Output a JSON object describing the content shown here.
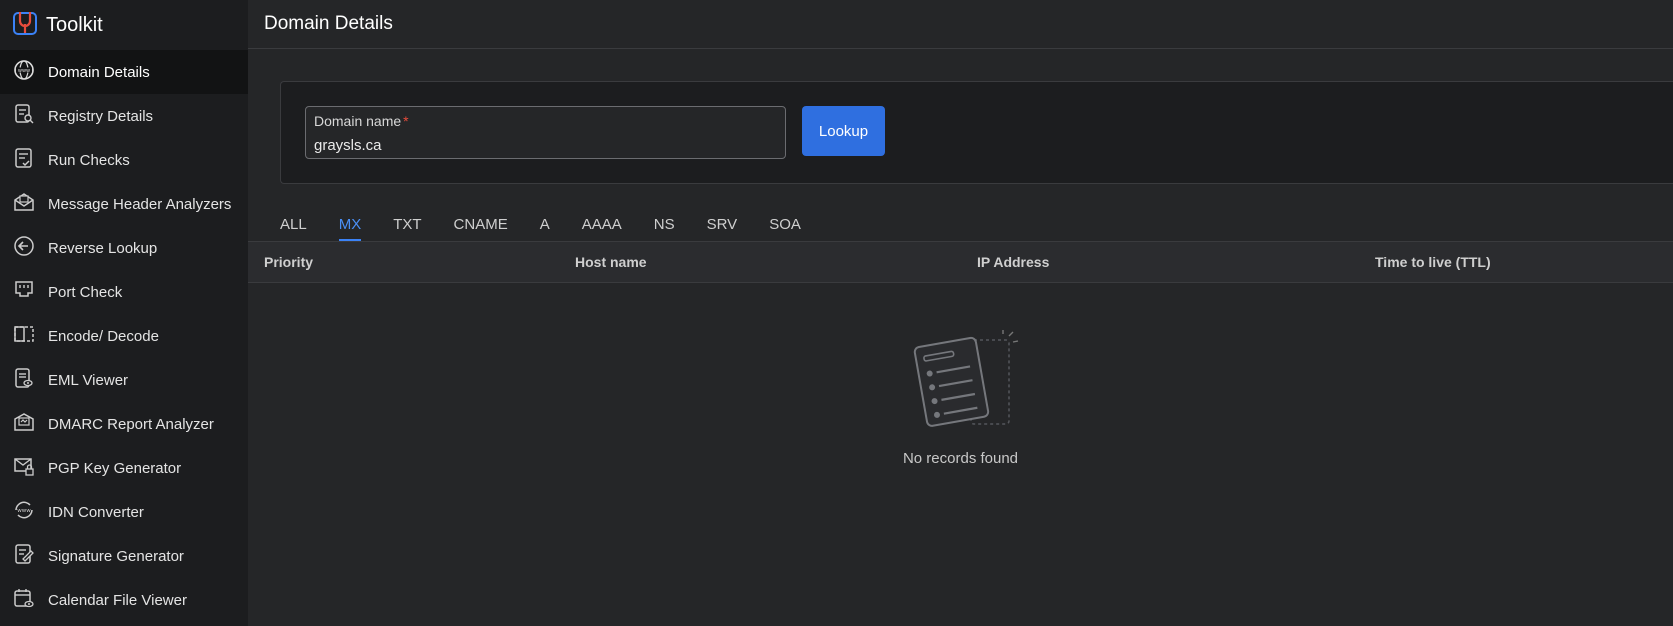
{
  "brand": {
    "name": "Toolkit",
    "logo_icon": "toolkit-logo-icon"
  },
  "sidebar": {
    "items": [
      {
        "label": "Domain Details",
        "icon": "globe-www-icon",
        "active": true
      },
      {
        "label": "Registry Details",
        "icon": "registry-doc-icon"
      },
      {
        "label": "Run Checks",
        "icon": "checklist-icon"
      },
      {
        "label": "Message Header Analyzers",
        "icon": "envelope-analyze-icon"
      },
      {
        "label": "Reverse Lookup",
        "icon": "reverse-arrow-icon"
      },
      {
        "label": "Port Check",
        "icon": "port-icon"
      },
      {
        "label": "Encode/ Decode",
        "icon": "split-box-icon"
      },
      {
        "label": "EML Viewer",
        "icon": "doc-eye-icon"
      },
      {
        "label": "DMARC Report Analyzer",
        "icon": "mail-report-icon"
      },
      {
        "label": "PGP Key Generator",
        "icon": "mail-lock-icon"
      },
      {
        "label": "IDN Converter",
        "icon": "www-refresh-icon"
      },
      {
        "label": "Signature Generator",
        "icon": "pen-doc-icon"
      },
      {
        "label": "Calendar File Viewer",
        "icon": "calendar-eye-icon"
      }
    ]
  },
  "header": {
    "title": "Domain Details"
  },
  "lookup": {
    "field_label": "Domain name",
    "required_mark": "*",
    "value": "graysls.ca",
    "button_label": "Lookup"
  },
  "tabs": [
    {
      "label": "ALL"
    },
    {
      "label": "MX",
      "active": true
    },
    {
      "label": "TXT"
    },
    {
      "label": "CNAME"
    },
    {
      "label": "A"
    },
    {
      "label": "AAAA"
    },
    {
      "label": "NS"
    },
    {
      "label": "SRV"
    },
    {
      "label": "SOA"
    }
  ],
  "table": {
    "columns": [
      "Priority",
      "Host name",
      "IP Address",
      "Time to live (TTL)"
    ]
  },
  "empty_state": {
    "icon": "empty-list-icon",
    "message": "No records found"
  },
  "colors": {
    "accent": "#2f6fe0",
    "active_tab": "#4a8ff5",
    "required": "#e74c3c"
  }
}
